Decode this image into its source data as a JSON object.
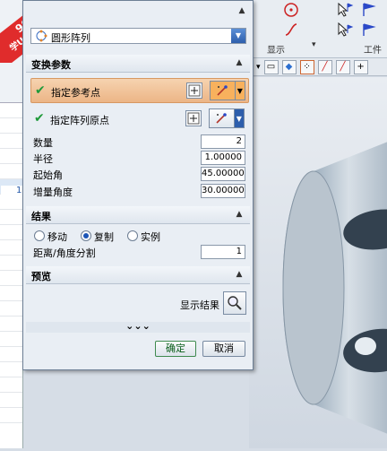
{
  "watermark": {
    "line1": "9SUG",
    "line2": "学UG就上UG网"
  },
  "toolbar": {
    "group_display_label": "显示",
    "group_tools_label": "工件"
  },
  "left_panel": {
    "selected_value": "1"
  },
  "dialog": {
    "type_select": {
      "value": "圆形阵列"
    },
    "section_transform": {
      "title": "变换参数",
      "ref_point_label": "指定参考点",
      "array_origin_label": "指定阵列原点",
      "fields": [
        {
          "label": "数量",
          "value": "2"
        },
        {
          "label": "半径",
          "value": "1.00000"
        },
        {
          "label": "起始角",
          "value": "45.00000"
        },
        {
          "label": "增量角度",
          "value": "30.00000"
        }
      ]
    },
    "section_result": {
      "title": "结果",
      "options": [
        "移动",
        "复制",
        "实例"
      ],
      "selected": "复制",
      "distance_label": "距离/角度分割",
      "distance_value": "1"
    },
    "section_preview": {
      "title": "预览",
      "show_result_label": "显示结果"
    },
    "more_indicator": "⌄⌄⌄",
    "ok_label": "确定",
    "cancel_label": "取消"
  },
  "colors": {
    "highlight_row": "#f0c29a",
    "accent_blue": "#1c55b6",
    "check_green": "#1f9a3a",
    "watermark_red": "#e02c2c"
  }
}
